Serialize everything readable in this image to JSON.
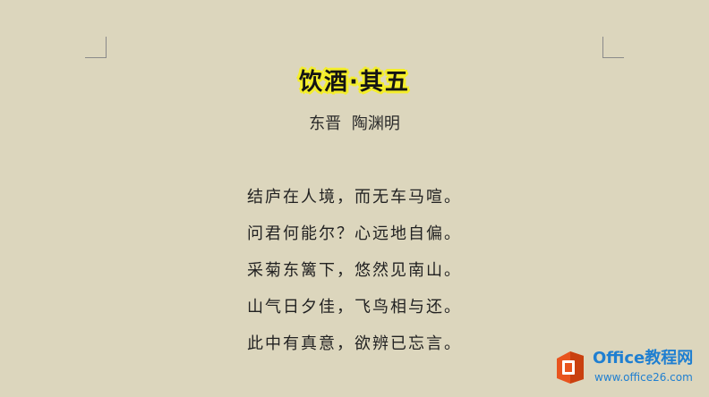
{
  "document": {
    "title": "饮酒·其五",
    "author": "东晋 陶渊明",
    "lines": [
      "结庐在人境，而无车马喧。",
      "问君何能尔？心远地自偏。",
      "采菊东篱下，悠然见南山。",
      "山气日夕佳，飞鸟相与还。",
      "此中有真意，欲辨已忘言。"
    ]
  },
  "watermark": {
    "name": "Office教程网",
    "url": "www.office26.com",
    "icon": "office-logo-icon"
  },
  "colors": {
    "page_background": "#dcd6bd",
    "title_highlight": "#f4ee2a",
    "watermark_blue": "#1f7fd1",
    "logo_orange": "#e8541e"
  }
}
